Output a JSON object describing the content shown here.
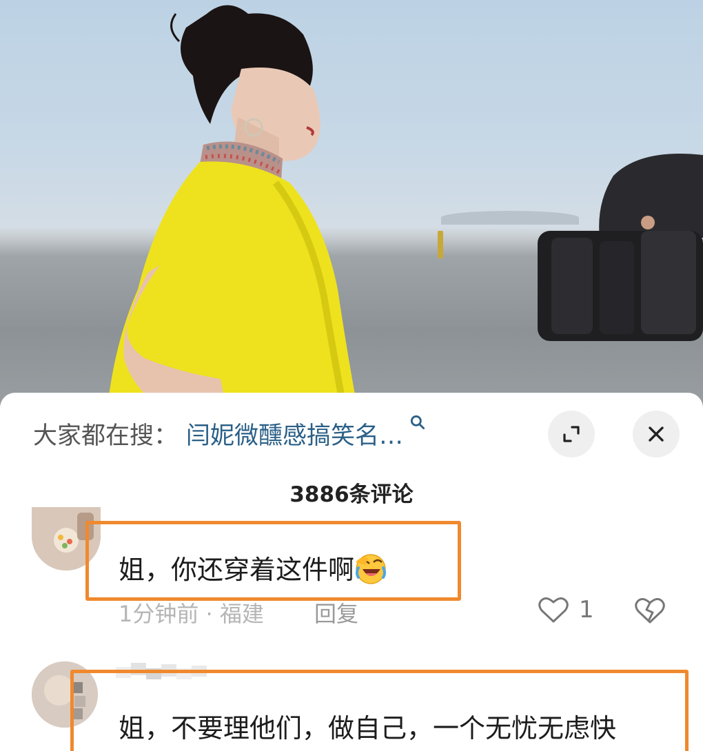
{
  "sheet": {
    "search_prefix": "大家都在搜：",
    "search_query": "闫妮微醺感搞笑名…",
    "comment_count": "3886条评论"
  },
  "comments": [
    {
      "text": "姐，你还穿着这件啊",
      "emoji": "laughing-crying-emoji",
      "time_location": "1分钟前 · 福建",
      "reply_label": "回复",
      "like_count": "1"
    },
    {
      "text": "姐，不要理他们，做自己，一个无忧无虑快"
    }
  ],
  "colors": {
    "highlight": "#f0892e",
    "search_link": "#2a5f87"
  }
}
